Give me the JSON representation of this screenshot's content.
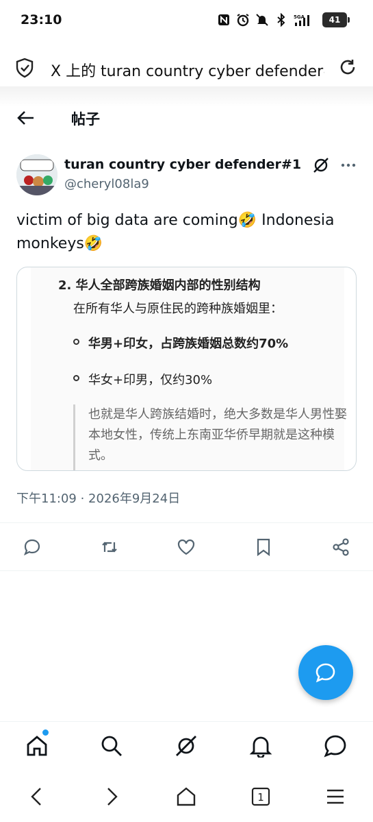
{
  "status_bar": {
    "time": "23:10",
    "battery": "41",
    "icons": [
      "nfc-icon",
      "alarm-icon",
      "mute-icon",
      "bluetooth-icon",
      "signal-5g-icon",
      "battery-icon"
    ]
  },
  "browser": {
    "title": "X 上的 turan country cyber defender#",
    "icons": [
      "shield-icon",
      "reload-icon"
    ]
  },
  "header": {
    "title": "帖子"
  },
  "post": {
    "author_name": "turan country cyber defender#1",
    "author_handle": "@cheryl08la9",
    "text": "victim of big data are coming🤣 Indonesia monkeys🤣",
    "timestamp": "下午11:09 · 2026年9月24日",
    "media": {
      "heading": "2. 华人全部跨族婚姻内部的性别结构",
      "subheading": "在所有华人与原住民的跨种族婚姻里：",
      "bullets": [
        "华男+印女，占跨族婚姻总数约70%",
        "华女+印男，仅约30%"
      ],
      "quote": "也就是华人跨族结婚时，绝大多数是华人男性娶本地女性，传统上东南亚华侨早期就是这种模式。"
    }
  },
  "actions": [
    "reply-icon",
    "repost-icon",
    "like-icon",
    "bookmark-icon",
    "share-icon"
  ],
  "bottom_nav": [
    "home-icon",
    "search-icon",
    "grok-icon",
    "notifications-icon",
    "messages-icon"
  ],
  "system_nav": {
    "tab_count": "1",
    "icons": [
      "back-icon",
      "forward-icon",
      "home-icon",
      "tabs-icon",
      "menu-icon"
    ]
  },
  "colors": {
    "accent": "#1d9bf0",
    "text": "#0f1419",
    "secondary_text": "#536471"
  }
}
